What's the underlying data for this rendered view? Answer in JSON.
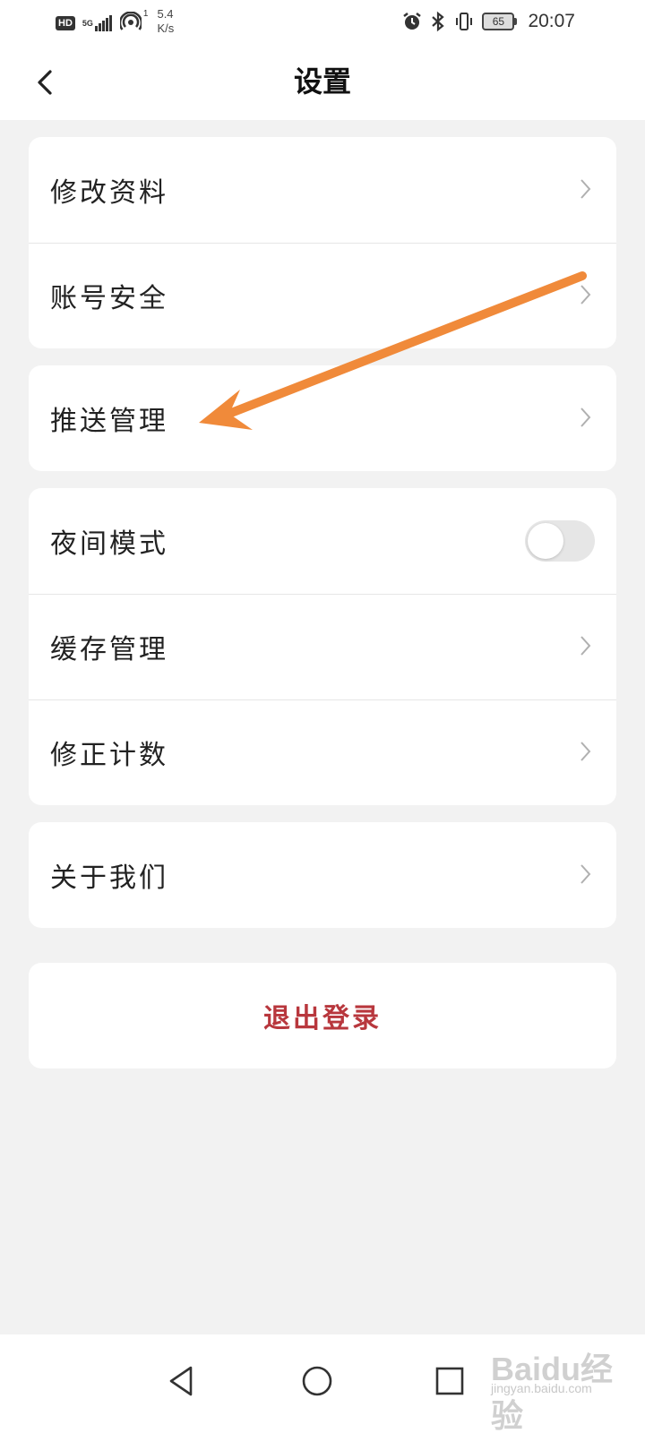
{
  "status_bar": {
    "hd": "HD",
    "network": "5G",
    "hotspot_count": "1",
    "speed_value": "5.4",
    "speed_unit": "K/s",
    "battery": "65",
    "time": "20:07"
  },
  "header": {
    "title": "设置",
    "back_icon": "chevron-left-icon"
  },
  "groups": [
    {
      "items": [
        {
          "label": "修改资料"
        },
        {
          "label": "账号安全"
        }
      ]
    },
    {
      "items": [
        {
          "label": "推送管理"
        }
      ]
    },
    {
      "items": [
        {
          "label": "夜间模式",
          "toggle": false
        },
        {
          "label": "缓存管理"
        },
        {
          "label": "修正计数"
        }
      ]
    },
    {
      "items": [
        {
          "label": "关于我们"
        }
      ]
    }
  ],
  "logout": {
    "label": "退出登录",
    "color": "#b8373d"
  },
  "annotation": {
    "color": "#f08a3a",
    "points_to": "推送管理"
  },
  "nav_bar": {
    "back_icon": "triangle-back-icon",
    "home_icon": "circle-home-icon",
    "recent_icon": "square-recent-icon"
  },
  "watermark": {
    "main": "Baidu经验",
    "sub": "jingyan.baidu.com"
  },
  "colors": {
    "background": "#f2f2f2",
    "card": "#ffffff",
    "divider": "#e6e6e6",
    "chevron": "#b0b0b0"
  }
}
